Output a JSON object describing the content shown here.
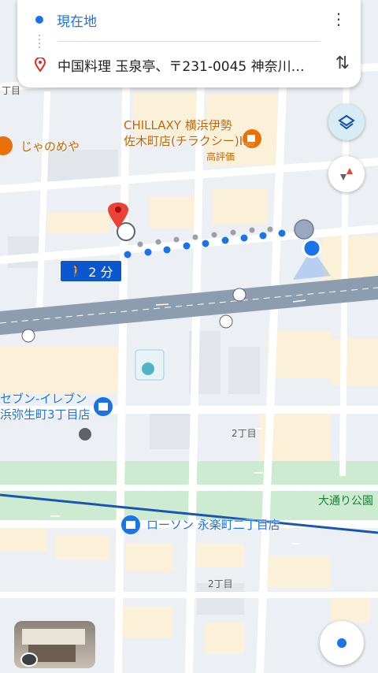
{
  "directions": {
    "origin_label": "現在地",
    "destination_label": "中国料理 玉泉亭、〒231-0045 神奈川…",
    "more_icon": "more-vert-icon",
    "swap_icon": "swap-vert-icon"
  },
  "route": {
    "duration_label": "2 分",
    "mode_icon": "walk-icon"
  },
  "map_labels": {
    "block_1": "丁目",
    "janomeya": "じゃのめや",
    "chillaxy_line1": "CHILLAXY 横浜伊勢",
    "chillaxy_line2": "佐木町店(チラクシー)I...",
    "chillaxy_rating": "高評価",
    "seven_line1": "セブン-イレブン",
    "seven_line2": "浜弥生町3丁目店",
    "block_2a": "2丁目",
    "park": "大通り公園",
    "lawson": "ローソン 永楽町二丁目店",
    "block_2b": "2丁目"
  },
  "controls": {
    "layers_icon": "layers-icon",
    "compass_icon": "compass-icon",
    "location_icon": "my-location-icon",
    "streetview_icon": "street-view-icon"
  },
  "colors": {
    "route_blue": "#1a73e8",
    "badge_blue": "#0b57d0",
    "pin_red": "#ea4335",
    "poi_orange": "#e8710a",
    "road_gray": "#8d9db0",
    "park_green": "#cdebd1"
  }
}
